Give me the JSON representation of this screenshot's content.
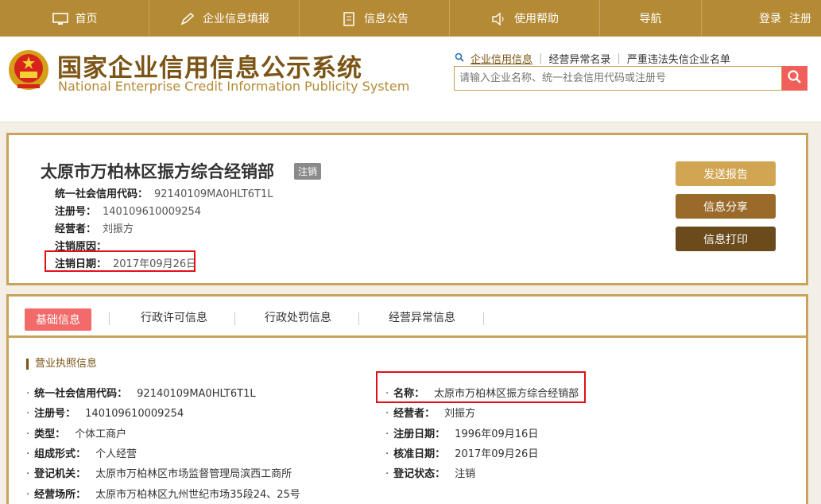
{
  "nav": {
    "items": [
      {
        "label": "首页",
        "icon": "monitor-icon"
      },
      {
        "label": "企业信息填报",
        "icon": "pen-icon"
      },
      {
        "label": "信息公告",
        "icon": "document-icon"
      },
      {
        "label": "使用帮助",
        "icon": "speaker-icon"
      },
      {
        "label": "导航",
        "icon": ""
      }
    ],
    "login": "登录",
    "register": "注册"
  },
  "header": {
    "title_cn": "国家企业信用信息公示系统",
    "title_en": "National Enterprise Credit Information Publicity System",
    "links": [
      "企业信用信息",
      "经营异常名录",
      "严重违法失信企业名单"
    ],
    "search_placeholder": "请输入企业名称、统一社会信用代码或注册号"
  },
  "summary": {
    "company_name": "太原市万柏林区振方综合经销部",
    "status_badge": "注销",
    "fields": [
      {
        "key": "统一社会信用代码：",
        "value": "92140109MA0HLT6T1L"
      },
      {
        "key": "注册号：",
        "value": "140109610009254"
      },
      {
        "key": "经营者：",
        "value": "刘振方"
      },
      {
        "key": "注销原因：",
        "value": ""
      },
      {
        "key": "注销日期：",
        "value": "2017年09月26日"
      }
    ],
    "buttons": {
      "send_report": "发送报告",
      "share": "信息分享",
      "print": "信息打印"
    }
  },
  "detail": {
    "tabs": [
      "基础信息",
      "行政许可信息",
      "行政处罚信息",
      "经营异常信息"
    ],
    "section_title": "营业执照信息",
    "left": [
      {
        "key": "统一社会信用代码：",
        "value": "92140109MA0HLT6T1L"
      },
      {
        "key": "注册号：",
        "value": "140109610009254"
      },
      {
        "key": "类型：",
        "value": "个体工商户"
      },
      {
        "key": "组成形式：",
        "value": "个人经营"
      },
      {
        "key": "登记机关：",
        "value": "太原市万柏林区市场监督管理局滨西工商所"
      },
      {
        "key": "经营场所：",
        "value": "太原市万柏林区九州世纪市场35段24、25号"
      }
    ],
    "right": [
      {
        "key": "名称：",
        "value": "太原市万柏林区振方综合经销部"
      },
      {
        "key": "经营者：",
        "value": "刘振方"
      },
      {
        "key": "注册日期：",
        "value": "1996年09月16日"
      },
      {
        "key": "核准日期：",
        "value": "2017年09月26日"
      },
      {
        "key": "登记状态：",
        "value": "注销"
      }
    ]
  },
  "colors": {
    "nav_bg": "#b58a35",
    "accent_red": "#f15f5a",
    "highlight_border": "#e0101a"
  }
}
